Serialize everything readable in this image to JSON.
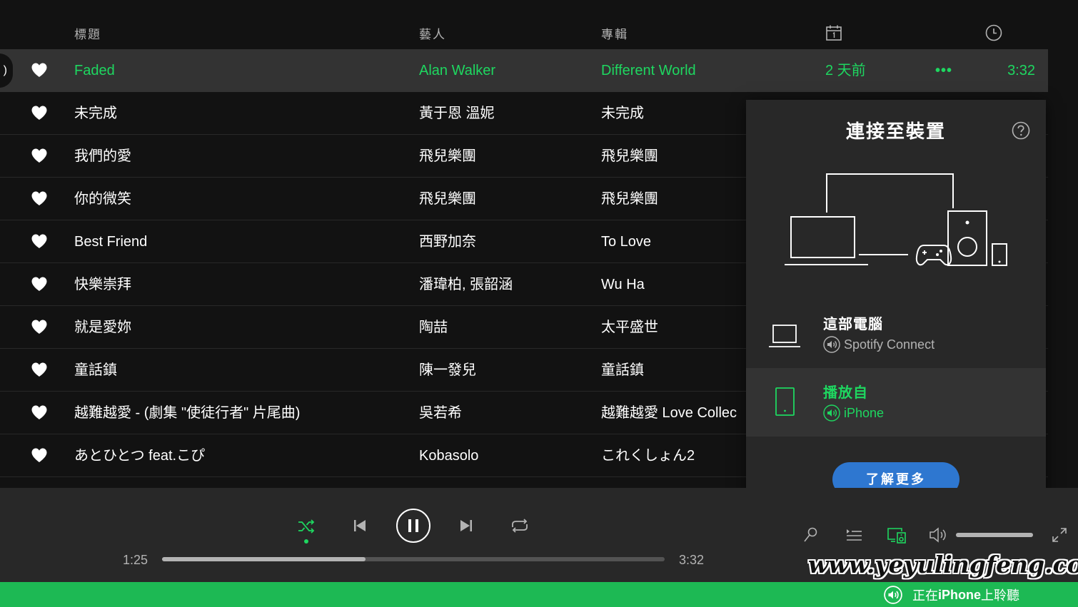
{
  "tracklist": {
    "headers": {
      "title": "標題",
      "artist": "藝人",
      "album": "專輯"
    },
    "header_icons": {
      "date": "calendar-icon",
      "duration": "clock-icon"
    },
    "rows": [
      {
        "title": "Faded",
        "artist": "Alan Walker",
        "album": "Different World",
        "date": "2 天前",
        "more": "•••",
        "duration": "3:32",
        "active": true
      },
      {
        "title": "未完成",
        "artist": "黃于恩 溫妮",
        "album": "未完成"
      },
      {
        "title": "我們的愛",
        "artist": "飛兒樂團",
        "album": "飛兒樂團"
      },
      {
        "title": "你的微笑",
        "artist": "飛兒樂團",
        "album": "飛兒樂團"
      },
      {
        "title": "Best Friend",
        "artist": "西野加奈",
        "album": "To Love"
      },
      {
        "title": "快樂崇拜",
        "artist": "潘瑋柏, 張韶涵",
        "album": "Wu Ha"
      },
      {
        "title": "就是愛妳",
        "artist": "陶喆",
        "album": "太平盛世"
      },
      {
        "title": "童話鎮",
        "artist": "陳一發兒",
        "album": "童話鎮"
      },
      {
        "title": "越難越愛 - (劇集 \"使徒行者\" 片尾曲)",
        "artist": "吳若希",
        "album": "越難越愛 Love Collec"
      },
      {
        "title": "あとひとつ feat.こぴ",
        "artist": "Kobasolo",
        "album": "これくしょん2"
      }
    ],
    "active_marker": ")"
  },
  "device_popup": {
    "title": "連接至裝置",
    "devices": [
      {
        "name": "這部電腦",
        "sub": "Spotify Connect",
        "icon": "laptop-icon"
      },
      {
        "name": "播放自",
        "sub": "iPhone",
        "icon": "phone-icon"
      }
    ],
    "learn_more": "了解更多"
  },
  "player": {
    "elapsed": "1:25",
    "total": "3:32",
    "progress_fraction": 0.405,
    "volume_fraction": 1.0,
    "watermark": "www.yeyulingfeng.com"
  },
  "status_bar": {
    "prefix": "正在",
    "device": "iPhone",
    "suffix": "上聆聽"
  },
  "colors": {
    "accent_green": "#1ed760",
    "status_green": "#1db954",
    "learn_blue": "#2e77d0",
    "background": "#121212"
  }
}
